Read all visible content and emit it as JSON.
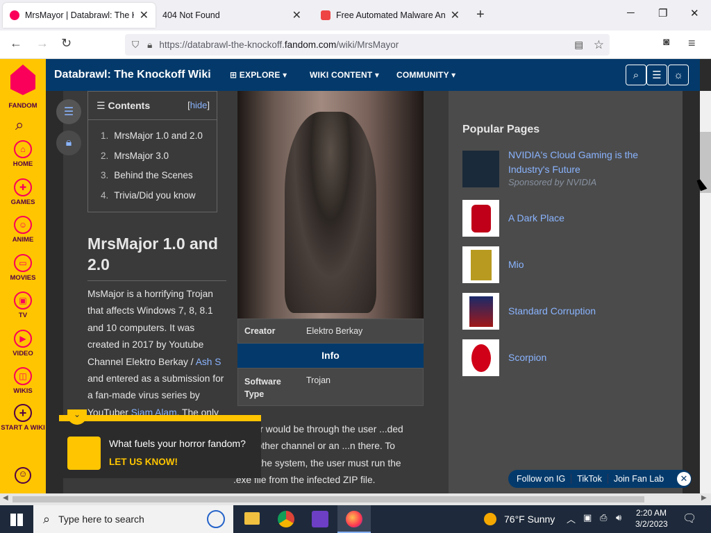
{
  "tabs": [
    {
      "title": "MrsMayor | Databrawl: The Knoc",
      "active": true,
      "color": "#fa005a"
    },
    {
      "title": "404 Not Found",
      "active": false,
      "color": ""
    },
    {
      "title": "Free Automated Malware Analy",
      "active": false,
      "color": "#e44"
    }
  ],
  "url": {
    "prefix": "https://databrawl-the-knockoff.",
    "domain": "fandom.com",
    "path": "/wiki/MrsMayor"
  },
  "rail": {
    "brand": "FANDOM",
    "items": [
      "HOME",
      "GAMES",
      "ANIME",
      "MOVIES",
      "TV",
      "VIDEO",
      "WIKIS",
      "START A WIKI"
    ]
  },
  "header": {
    "title": "Databrawl: The Knockoff Wiki",
    "menu": [
      "EXPLORE",
      "WIKI CONTENT",
      "COMMUNITY"
    ]
  },
  "toc": {
    "title": "Contents",
    "hide_pre": "[",
    "hide": "hide",
    "hide_post": "]",
    "items": [
      {
        "n": "1.",
        "t": "MrsMajor 1.0 and 2.0"
      },
      {
        "n": "2.",
        "t": "MrsMajor 3.0"
      },
      {
        "n": "3.",
        "t": "Behind the Scenes"
      },
      {
        "n": "4.",
        "t": "Trivia/Did you know"
      }
    ]
  },
  "article": {
    "heading": "MrsMajor 1.0 and 2.0",
    "p1a": "MsMajor is a horrifying Trojan that affects Windows 7, 8, 8.1 and 10 computers. It was created in 2017 by Youtube Channel Elektro Berkay / ",
    "p1link": "Ash S",
    "p1b": " and entered as a submission for a fan-made virus series by YouTuber ",
    "p1link2": "Siam Alam",
    "p1c": ". The only",
    "p2": "...puter would be through the user ...ded by another channel or an ...n there. To infect the system, the user must run the .exe file from the infected ZIP file."
  },
  "infobox": {
    "creator_label": "Creator",
    "creator": "Elektro Berkay",
    "section": "Info",
    "type_label": "Software Type",
    "type": "Trojan"
  },
  "popular": {
    "title": "Popular Pages",
    "items": [
      {
        "t": "NVIDIA's Cloud Gaming is the Industry's Future",
        "s": "Sponsored by NVIDIA"
      },
      {
        "t": "A Dark Place",
        "s": ""
      },
      {
        "t": "Mio",
        "s": ""
      },
      {
        "t": "Standard Corruption",
        "s": ""
      },
      {
        "t": "Scorpion",
        "s": ""
      }
    ]
  },
  "toast": {
    "q": "What fuels your horror fandom?",
    "cta": "LET US KNOW!"
  },
  "social": [
    "Follow on IG",
    "TikTok",
    "Join Fan Lab"
  ],
  "taskbar": {
    "search": "Type here to search",
    "weather": "76°F  Sunny",
    "time": "2:20 AM",
    "date": "3/2/2023"
  }
}
